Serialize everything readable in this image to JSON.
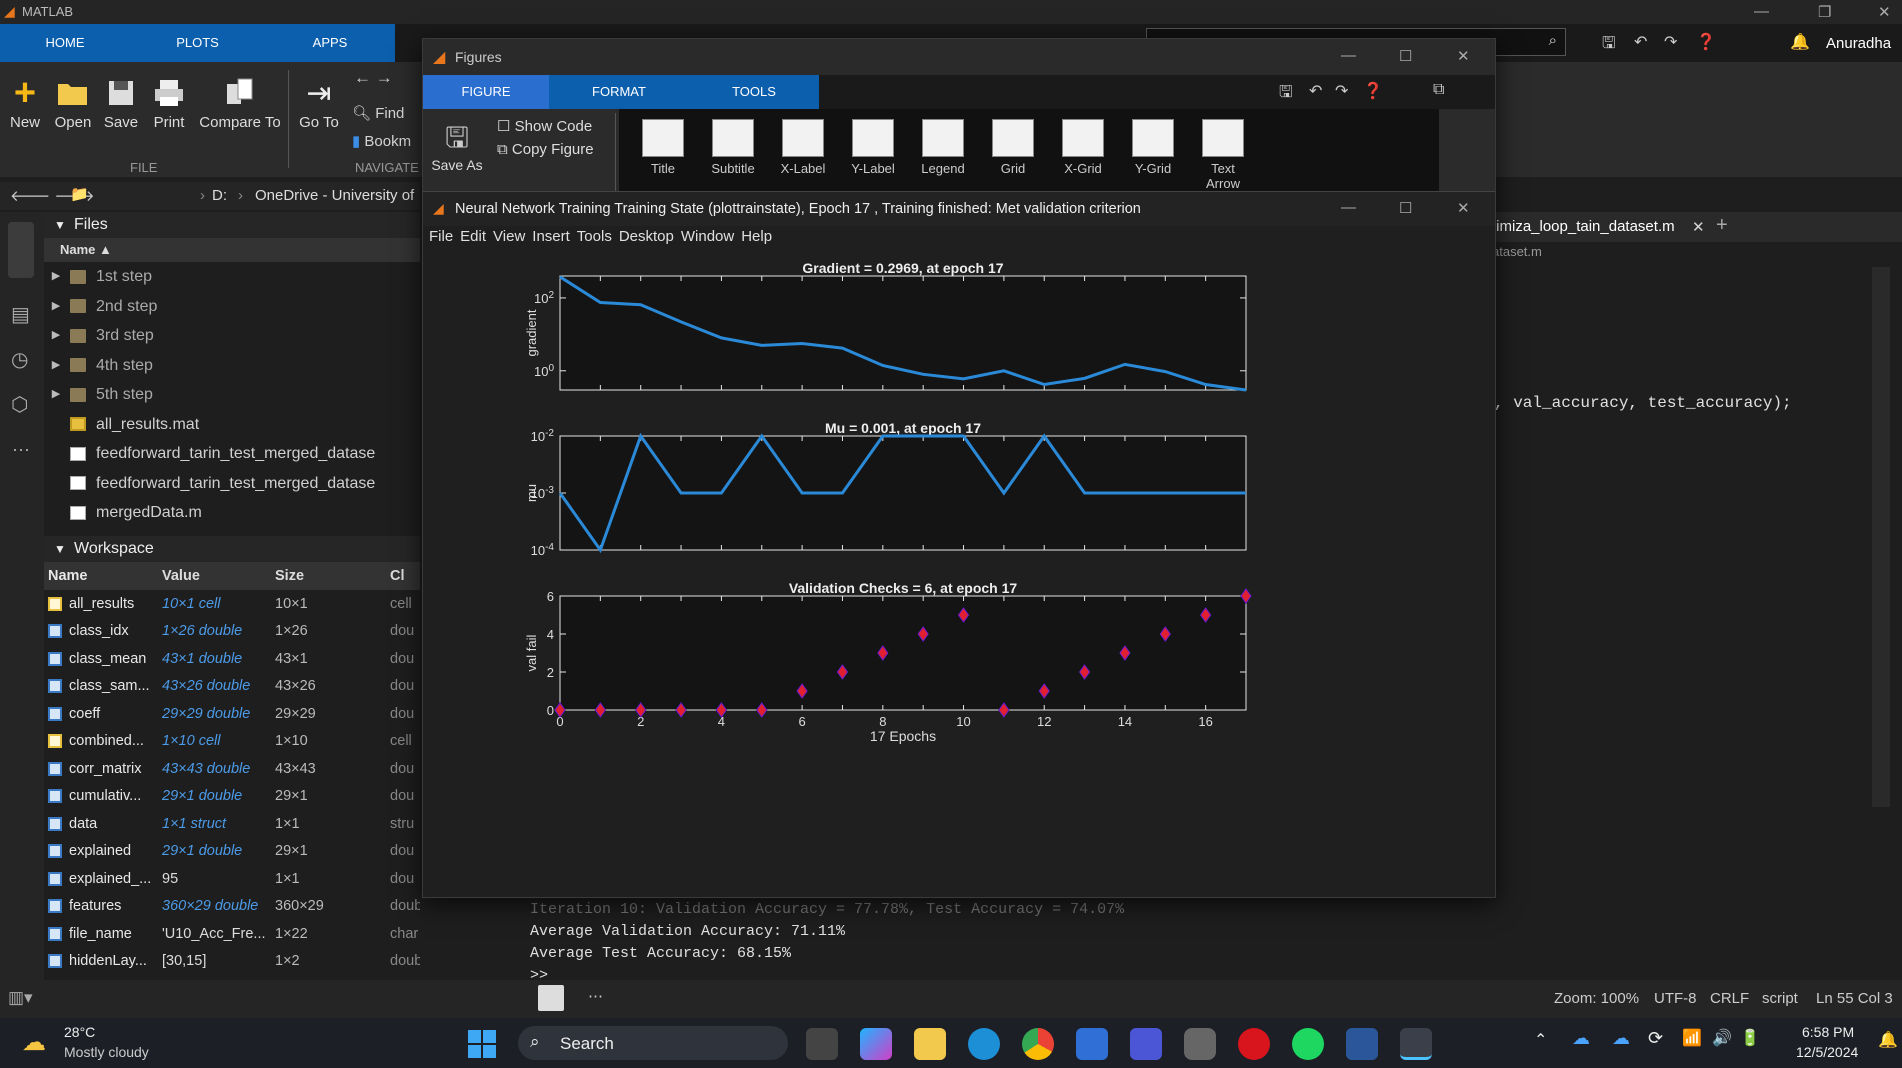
{
  "app": {
    "title": "MATLAB",
    "user": "Anuradha"
  },
  "ribbon": {
    "tabs": [
      "HOME",
      "PLOTS",
      "APPS"
    ],
    "buttons": {
      "new": "New",
      "open": "Open",
      "save": "Save",
      "print": "Print",
      "compare": "Compare To",
      "goto": "Go To",
      "find": "Find",
      "bookmark": "Bookm"
    },
    "sections": {
      "file": "FILE",
      "navigate": "NAVIGATE"
    }
  },
  "address": {
    "drive": "D:",
    "path": "OneDrive - University of"
  },
  "files": {
    "title": "Files",
    "col_name": "Name",
    "items": [
      {
        "name": "1st step",
        "type": "folder"
      },
      {
        "name": "2nd step",
        "type": "folder"
      },
      {
        "name": "3rd step",
        "type": "folder"
      },
      {
        "name": "4th step",
        "type": "folder"
      },
      {
        "name": "5th step",
        "type": "folder"
      },
      {
        "name": "all_results.mat",
        "type": "mat"
      },
      {
        "name": "feedforward_tarin_test_merged_datase",
        "type": "file"
      },
      {
        "name": "feedforward_tarin_test_merged_datase",
        "type": "script"
      },
      {
        "name": "mergedData.m",
        "type": "script"
      }
    ]
  },
  "workspace": {
    "title": "Workspace",
    "columns": [
      "Name",
      "Value",
      "Size",
      "Cl"
    ],
    "rows": [
      {
        "name": "all_results",
        "value": "10×1 cell",
        "size": "10×1",
        "cls": "cell",
        "icon": "cell",
        "link": true
      },
      {
        "name": "class_idx",
        "value": "1×26 double",
        "size": "1×26",
        "cls": "dou",
        "icon": "grid",
        "link": true
      },
      {
        "name": "class_mean",
        "value": "43×1 double",
        "size": "43×1",
        "cls": "dou",
        "icon": "grid",
        "link": true
      },
      {
        "name": "class_sam...",
        "value": "43×26 double",
        "size": "43×26",
        "cls": "dou",
        "icon": "grid",
        "link": true
      },
      {
        "name": "coeff",
        "value": "29×29 double",
        "size": "29×29",
        "cls": "dou",
        "icon": "grid",
        "link": true
      },
      {
        "name": "combined...",
        "value": "1×10 cell",
        "size": "1×10",
        "cls": "cell",
        "icon": "cell",
        "link": true
      },
      {
        "name": "corr_matrix",
        "value": "43×43 double",
        "size": "43×43",
        "cls": "dou",
        "icon": "grid",
        "link": true
      },
      {
        "name": "cumulativ...",
        "value": "29×1 double",
        "size": "29×1",
        "cls": "dou",
        "icon": "grid",
        "link": true
      },
      {
        "name": "data",
        "value": "1×1 struct",
        "size": "1×1",
        "cls": "stru",
        "icon": "struct",
        "link": true
      },
      {
        "name": "explained",
        "value": "29×1 double",
        "size": "29×1",
        "cls": "dou",
        "icon": "grid",
        "link": true
      },
      {
        "name": "explained_...",
        "value": "95",
        "size": "1×1",
        "cls": "dou",
        "icon": "grid",
        "link": false
      },
      {
        "name": "features",
        "value": "360×29 double",
        "size": "360×29",
        "cls": "double",
        "icon": "grid",
        "link": true
      },
      {
        "name": "file_name",
        "value": "'U10_Acc_Fre...",
        "size": "1×22",
        "cls": "char",
        "icon": "char",
        "link": false
      },
      {
        "name": "hiddenLay...",
        "value": "[30,15]",
        "size": "1×2",
        "cls": "double",
        "icon": "grid",
        "link": false
      }
    ]
  },
  "editor": {
    "tab": "timiza_loop_tain_dataset.m",
    "breadcrumb": "ataset.m",
    "code": ", val_accuracy, test_accuracy);"
  },
  "command": {
    "lines": [
      "Iteration 10: Validation Accuracy = 77.78%, Test Accuracy = 74.07%",
      "Average Validation Accuracy: 71.11%",
      "Average Test Accuracy: 68.15%"
    ],
    "prompt": ">>"
  },
  "status": {
    "zoom": "Zoom: 100%",
    "encoding": "UTF-8",
    "eol": "CRLF",
    "type": "script",
    "pos": "Ln 55 Col 3"
  },
  "taskbar": {
    "temp": "28°C",
    "weather": "Mostly cloudy",
    "search": "Search",
    "time": "6:58 PM",
    "date": "12/5/2024"
  },
  "figures": {
    "title": "Figures",
    "tabs": [
      "FIGURE",
      "FORMAT",
      "TOOLS"
    ],
    "saveas": "Save As",
    "show_code": "Show Code",
    "copy_figure": "Copy Figure",
    "gallery": [
      "Title",
      "Subtitle",
      "X-Label",
      "Y-Label",
      "Legend",
      "Grid",
      "X-Grid",
      "Y-Grid",
      "Text Arrow"
    ]
  },
  "training": {
    "title": "Neural Network Training Training State (plottrainstate), Epoch 17 , Training finished: Met validation criterion",
    "menu": [
      "File",
      "Edit",
      "View",
      "Insert",
      "Tools",
      "Desktop",
      "Window",
      "Help"
    ]
  },
  "chart_data": [
    {
      "type": "line",
      "title": "Gradient = 0.2969, at epoch 17",
      "ylabel": "gradient",
      "yscale": "log",
      "ylim": [
        0.2969,
        400
      ],
      "yticks": [
        "10^2",
        "10^0"
      ],
      "x": [
        0,
        1,
        2,
        3,
        4,
        5,
        6,
        7,
        8,
        9,
        10,
        11,
        12,
        13,
        14,
        15,
        16,
        17
      ],
      "values": [
        380,
        75,
        65,
        22,
        8,
        5,
        5.6,
        4.2,
        1.4,
        0.8,
        0.6,
        1.0,
        0.42,
        0.62,
        1.5,
        0.95,
        0.42,
        0.2969
      ],
      "color": "#2b8ad8"
    },
    {
      "type": "line",
      "title": "Mu = 0.001, at epoch 17",
      "ylabel": "mu",
      "yscale": "log",
      "ylim": [
        0.0001,
        0.01
      ],
      "yticks": [
        "10^-2",
        "10^-3",
        "10^-4"
      ],
      "x": [
        0,
        1,
        2,
        3,
        4,
        5,
        6,
        7,
        8,
        9,
        10,
        11,
        12,
        13,
        14,
        15,
        16,
        17
      ],
      "values": [
        0.001,
        0.0001,
        0.01,
        0.001,
        0.001,
        0.01,
        0.001,
        0.001,
        0.01,
        0.01,
        0.01,
        0.001,
        0.01,
        0.001,
        0.001,
        0.001,
        0.001,
        0.001
      ],
      "color": "#2b8ad8"
    },
    {
      "type": "scatter",
      "title": "Validation Checks = 6, at epoch 17",
      "ylabel": "val fail",
      "xlabel": "17 Epochs",
      "xlim": [
        0,
        17
      ],
      "ylim": [
        0,
        6
      ],
      "xticks": [
        0,
        2,
        4,
        6,
        8,
        10,
        12,
        14,
        16
      ],
      "yticks": [
        0,
        2,
        4,
        6
      ],
      "x": [
        0,
        1,
        2,
        3,
        4,
        5,
        6,
        7,
        8,
        9,
        10,
        11,
        12,
        13,
        14,
        15,
        16,
        17
      ],
      "values": [
        0,
        0,
        0,
        0,
        0,
        0,
        1,
        2,
        3,
        4,
        5,
        0,
        1,
        2,
        3,
        4,
        5,
        6
      ],
      "color": "#e02030"
    }
  ]
}
